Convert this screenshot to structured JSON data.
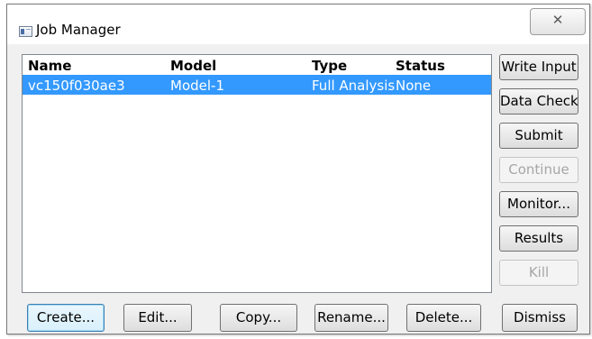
{
  "window": {
    "title": "Job Manager",
    "close_symbol": "✕"
  },
  "jobs_table": {
    "columns": [
      "Name",
      "Model",
      "Type",
      "Status"
    ],
    "rows": [
      {
        "name": "vc150f030ae3",
        "model": "Model-1",
        "type": "Full Analysis",
        "status": "None",
        "selected": true
      }
    ],
    "selection_color": "#3399ff"
  },
  "side_buttons": [
    {
      "label": "Write Input",
      "enabled": true
    },
    {
      "label": "Data Check",
      "enabled": true
    },
    {
      "label": "Submit",
      "enabled": true
    },
    {
      "label": "Continue",
      "enabled": false
    },
    {
      "label": "Monitor...",
      "enabled": true
    },
    {
      "label": "Results",
      "enabled": true
    },
    {
      "label": "Kill",
      "enabled": false
    }
  ],
  "bottom_buttons": [
    {
      "label": "Create...",
      "default": true
    },
    {
      "label": "Edit...",
      "default": false
    },
    {
      "label": "Copy...",
      "default": false
    },
    {
      "label": "Rename...",
      "default": false
    },
    {
      "label": "Delete...",
      "default": false
    },
    {
      "label": "Dismiss",
      "default": false
    }
  ]
}
